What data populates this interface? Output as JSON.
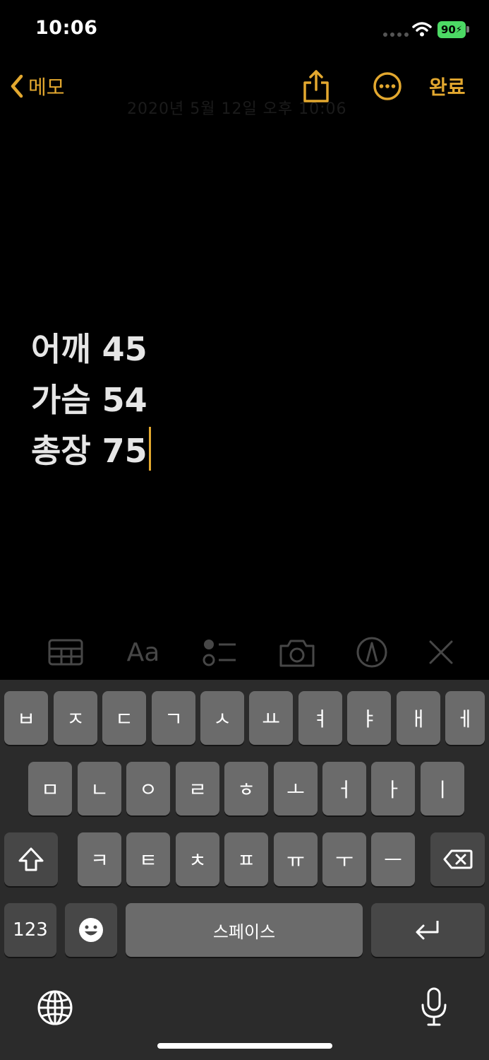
{
  "status_bar": {
    "time": "10:06",
    "battery": "90"
  },
  "nav": {
    "back_label": "메모",
    "done_label": "완료"
  },
  "note": {
    "date_ghost": "2020년 5월 12일 오후 10:06",
    "lines": [
      "어깨 45",
      "가슴 54",
      "총장 75"
    ]
  },
  "toolbar": {
    "format_label": "Aa"
  },
  "keyboard": {
    "row1": [
      "ㅂ",
      "ㅈ",
      "ㄷ",
      "ㄱ",
      "ㅅ",
      "ㅛ",
      "ㅕ",
      "ㅑ",
      "ㅐ",
      "ㅔ"
    ],
    "row2": [
      "ㅁ",
      "ㄴ",
      "ㅇ",
      "ㄹ",
      "ㅎ",
      "ㅗ",
      "ㅓ",
      "ㅏ",
      "ㅣ"
    ],
    "row3": [
      "ㅋ",
      "ㅌ",
      "ㅊ",
      "ㅍ",
      "ㅠ",
      "ㅜ",
      "ㅡ"
    ],
    "numbers_label": "123",
    "space_label": "스페이스"
  },
  "colors": {
    "accent": "#e3a82f",
    "key": "#6b6b6b",
    "key_dark": "#474747",
    "keyboard_bg": "#2b2b2b"
  }
}
